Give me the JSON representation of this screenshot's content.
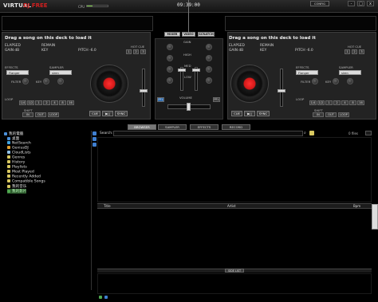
{
  "app": {
    "logo_main": "VIRTUAL",
    "logo_sub": "DJ FREE",
    "cpu_label": "CPU",
    "clock": "09:39:00",
    "config_label": "CONFIG",
    "window_buttons": [
      "-",
      "□",
      "x"
    ]
  },
  "center_tabs": [
    "MIXER",
    "VIDEO",
    "SCRATCH"
  ],
  "left_deck": {
    "title": "Drag a song on this deck to load it",
    "elapsed": "ELAPSED",
    "remain": "REMAIN",
    "gain": "GAIN dB",
    "key": "KEY",
    "pitch": "PITCH -6.0",
    "effects_label": "EFFECTS",
    "effect_value": "Flanger",
    "sampler_label": "SAMPLER",
    "sampler_value": "siren",
    "filter_label": "FILTER",
    "key_label": "KEY",
    "loop_label": "LOOP",
    "shift_label": "SHIFT",
    "hotcue_label": "HOT CUE",
    "hotcues": [
      "1",
      "2",
      "3"
    ],
    "loop_values": [
      "1/4",
      "1/2",
      "1",
      "2",
      "4",
      "8",
      "16"
    ],
    "cue_label": "CUE",
    "play_label": "▶||",
    "sync_label": "SYNC",
    "in_label": "IN",
    "out_label": "OUT"
  },
  "right_deck": {
    "title": "Drag a song on this deck to load it",
    "elapsed": "ELAPSED",
    "remain": "REMAIN",
    "gain": "GAIN dB",
    "key": "KEY",
    "pitch": "PITCH -6.0",
    "effects_label": "EFFECTS",
    "effect_value": "Flanger",
    "sampler_label": "SAMPLER",
    "sampler_value": "siren",
    "filter_label": "FILTER",
    "key_label": "KEY",
    "loop_label": "LOOP",
    "shift_label": "SHIFT",
    "hotcue_label": "HOT CUE",
    "hotcues": [
      "1",
      "2",
      "3"
    ],
    "loop_values": [
      "1/4",
      "1/2",
      "1",
      "2",
      "4",
      "8",
      "16"
    ],
    "cue_label": "CUE",
    "play_label": "▶||",
    "sync_label": "SYNC",
    "in_label": "IN",
    "out_label": "OUT"
  },
  "mixer": {
    "gain_label": "GAIN",
    "high_label": "HIGH",
    "med_label": "MED",
    "low_label": "LOW",
    "pfl_label": "PFL",
    "volume_label": "VOLUME",
    "cross_label": "CROSSFADER"
  },
  "browser_tabs": [
    "BROWSER",
    "SAMPLER",
    "EFFECTS",
    "RECORD"
  ],
  "tree": [
    {
      "label": "我的電腦",
      "color": "#4a8fd8"
    },
    {
      "label": "桌面",
      "color": "#4a8fd8"
    },
    {
      "label": "NetSearch",
      "color": "#3fa3e0"
    },
    {
      "label": "GeniusDJ",
      "color": "#e0a030"
    },
    {
      "label": "CloudLists",
      "color": "#8fc1e8"
    },
    {
      "label": "Genres",
      "color": "#d8c860"
    },
    {
      "label": "History",
      "color": "#d8c860"
    },
    {
      "label": "Playlists",
      "color": "#d8c860"
    },
    {
      "label": "Most Played",
      "color": "#d8c860"
    },
    {
      "label": "Recently Added",
      "color": "#d8c860"
    },
    {
      "label": "Compatible Songs",
      "color": "#d8c860"
    },
    {
      "label": "我的音乐",
      "color": "#d8c860"
    },
    {
      "label": "我的影片",
      "color": "#4fa84f"
    }
  ],
  "search": {
    "label": "Search:",
    "placeholder": ""
  },
  "file_count": "0 files",
  "columns": {
    "title": "Title",
    "artist": "Artist",
    "bpm": "Bpm"
  },
  "side_list_label": "SIDE LIST"
}
